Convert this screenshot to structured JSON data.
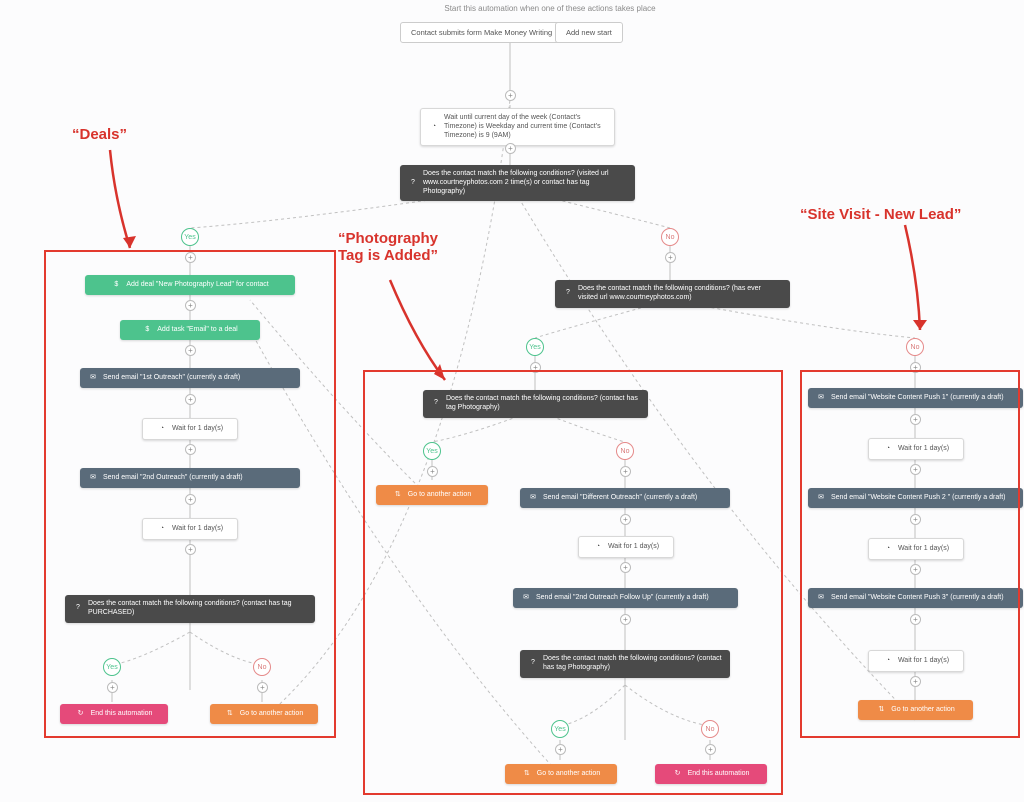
{
  "header": {
    "prompt": "Start this automation when one of these actions takes place",
    "start1": "Contact submits form Make Money Writing",
    "start2": "Add new start"
  },
  "wait_weekday": "Wait until current day of the week (Contact's Timezone) is Weekday and current time (Contact's Timezone) is 9 (9AM)",
  "cond_root": "Does the contact match the following conditions? (visited url www.courtneyphotos.com 2 time(s) or contact has tag Photography)",
  "deals": {
    "add_deal": "Add deal \"New Photography Lead\" for contact",
    "add_task": "Add task \"Email\" to a deal",
    "email1": "Send email \"1st Outreach\" (currently a draft)",
    "wait1": "Wait for 1 day(s)",
    "email2": "Send email \"2nd Outreach\" (currently a draft)",
    "wait2": "Wait for 1 day(s)",
    "cond_purchased": "Does the contact match the following conditions? (contact has tag PURCHASED)",
    "end": "End this automation",
    "goto": "Go to another action"
  },
  "cond_ever": "Does the contact match the following conditions? (has ever visited url www.courtneyphotos.com)",
  "photo": {
    "cond_tag": "Does the contact match the following conditions? (contact has tag Photography)",
    "goto_yes": "Go to another action",
    "email_diff": "Send email \"Different Outreach\" (currently a draft)",
    "wait1": "Wait for 1 day(s)",
    "email_2nd": "Send email \"2nd Outreach Follow Up\" (currently a draft)",
    "cond_tag2": "Does the contact match the following conditions? (contact has tag Photography)",
    "goto2": "Go to another action",
    "end": "End this automation"
  },
  "site": {
    "push1": "Send email \"Website Content Push 1\" (currently a draft)",
    "wait1": "Wait for 1 day(s)",
    "push2": "Send email \"Website Content Push 2 \" (currently a draft)",
    "wait2": "Wait for 1 day(s)",
    "push3": "Send email \"Website Content Push 3\" (currently a draft)",
    "wait3": "Wait for 1 day(s)",
    "goto": "Go to another action"
  },
  "labels": {
    "yes": "Yes",
    "no": "No"
  },
  "annotations": {
    "deals": "“Deals”",
    "photo": "“Photography\nTag is Added”",
    "site": "“Site Visit - New Lead”"
  }
}
